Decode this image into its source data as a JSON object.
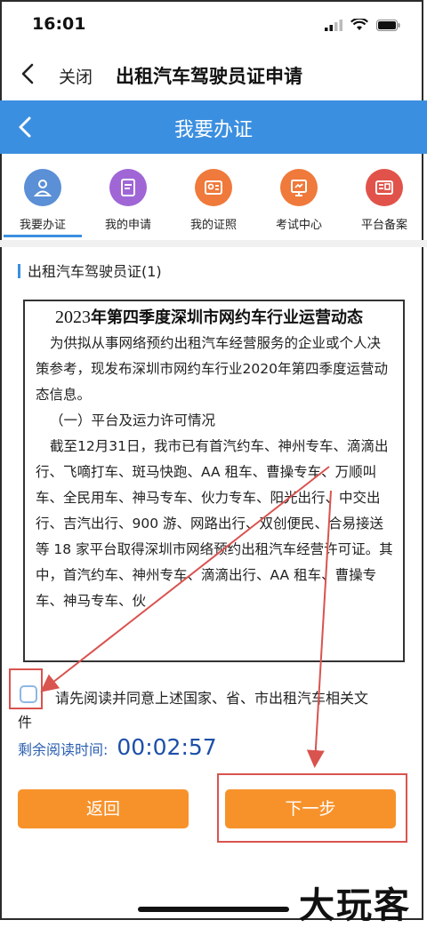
{
  "status_bar": {
    "time": "16:01"
  },
  "nav": {
    "close_label": "关闭",
    "title": "出租汽车驾驶员证申请"
  },
  "header": {
    "title": "我要办证"
  },
  "menu": {
    "items": [
      {
        "label": "我要办证",
        "icon": "person-icon",
        "color": "#5b8fd6"
      },
      {
        "label": "我的申请",
        "icon": "application-icon",
        "color": "#a066d6"
      },
      {
        "label": "我的证照",
        "icon": "license-icon",
        "color": "#ef7a3b"
      },
      {
        "label": "考试中心",
        "icon": "exam-icon",
        "color": "#ef7a3b"
      },
      {
        "label": "平台备案",
        "icon": "record-icon",
        "color": "#e1534a"
      }
    ]
  },
  "section": {
    "title": "出租汽车驾驶员证(1)"
  },
  "document": {
    "title_year": "2023",
    "title_rest": "年第四季度深圳市网约车行业运营动态",
    "paragraphs": [
      "为供拟从事网络预约出租汽车经营服务的企业或个人决策参考，现发布深圳市网约车行业2020年第四季度运营动态信息。",
      "（一）平台及运力许可情况",
      "截至12月31日，我市已有首汽约车、神州专车、滴滴出行、飞嘀打车、斑马快跑、AA 租车、曹操专车、万顺叫车、全民用车、神马专车、伙力专车、阳光出行、中交出行、吉汽出行、900 游、网路出行、双创便民、合易接送等 18 家平台取得深圳市网络预约出租汽车经营许可证。其中，首汽约车、神州专车、滴滴出行、AA 租车、曹操专车、神马专车、伙"
    ]
  },
  "agreement": {
    "text": "请先阅读并同意上述国家、省、市出租汽车相关文",
    "text_wrap": "件"
  },
  "timer": {
    "label": "剩余阅读时间:",
    "value": "00:02:57"
  },
  "buttons": {
    "back": "返回",
    "next": "下一步"
  },
  "watermark": "大玩客",
  "colors": {
    "primary": "#3b8fe0",
    "button": "#f7922b",
    "annotation": "#d9534f"
  }
}
